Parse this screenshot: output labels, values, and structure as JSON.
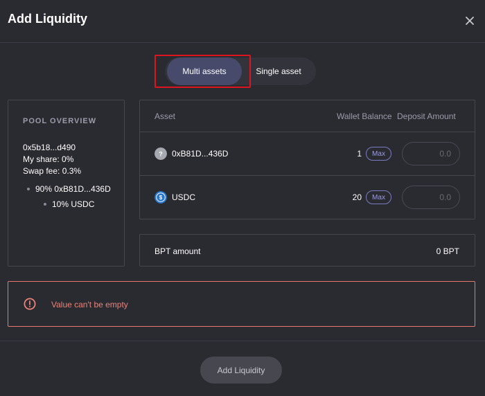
{
  "dialog": {
    "title": "Add Liquidity"
  },
  "tabs": {
    "multi_label": "Multi assets",
    "single_label": "Single asset",
    "active": "Multi assets"
  },
  "pool_overview": {
    "heading": "POOL OVERVIEW",
    "address": "0x5b18...d490",
    "my_share": "My share: 0%",
    "swap_fee": "Swap fee: 0.3%",
    "weights": [
      {
        "label": "90% 0xB81D...436D"
      },
      {
        "label": "10% USDC"
      }
    ]
  },
  "table": {
    "headers": {
      "asset": "Asset",
      "wallet_balance": "Wallet Balance",
      "deposit_amount": "Deposit Amount"
    },
    "rows": [
      {
        "icon": "unknown-token-icon",
        "name": "0xB81D...436D",
        "balance": "1",
        "max_label": "Max",
        "deposit_placeholder": "0.0"
      },
      {
        "icon": "usdc-token-icon",
        "name": "USDC",
        "balance": "20",
        "max_label": "Max",
        "deposit_placeholder": "0.0"
      }
    ]
  },
  "bpt": {
    "label": "BPT amount",
    "value": "0 BPT"
  },
  "error": {
    "icon": "alert-circle-icon",
    "message": "Value can't be empty",
    "color": "#ec8377"
  },
  "submit": {
    "label": "Add Liquidity"
  },
  "colors": {
    "background": "#2a2a31",
    "accent": "#484a6c",
    "highlight": "#e0141e"
  }
}
